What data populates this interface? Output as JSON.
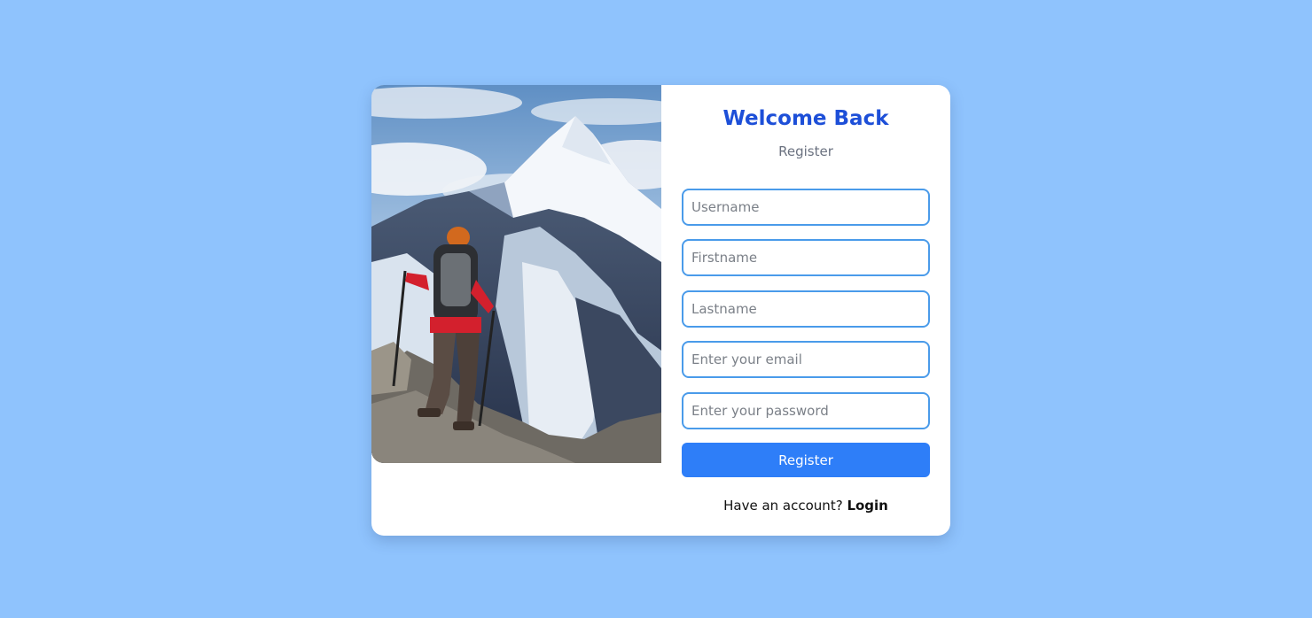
{
  "form": {
    "title": "Welcome Back",
    "subtitle": "Register",
    "fields": {
      "username": {
        "placeholder": "Username",
        "value": ""
      },
      "firstname": {
        "placeholder": "Firstname",
        "value": ""
      },
      "lastname": {
        "placeholder": "Lastname",
        "value": ""
      },
      "email": {
        "placeholder": "Enter your email",
        "value": ""
      },
      "password": {
        "placeholder": "Enter your password",
        "value": ""
      }
    },
    "submit_label": "Register",
    "footer_text": "Have an account?",
    "login_link": "Login"
  },
  "colors": {
    "page_background": "#8fc3fd",
    "title": "#1d4fd8",
    "field_border": "#4a9bea",
    "button": "#2e7ef8"
  },
  "image": {
    "subject": "hiker-with-trekking-poles-facing-snowy-mountain-peak"
  }
}
